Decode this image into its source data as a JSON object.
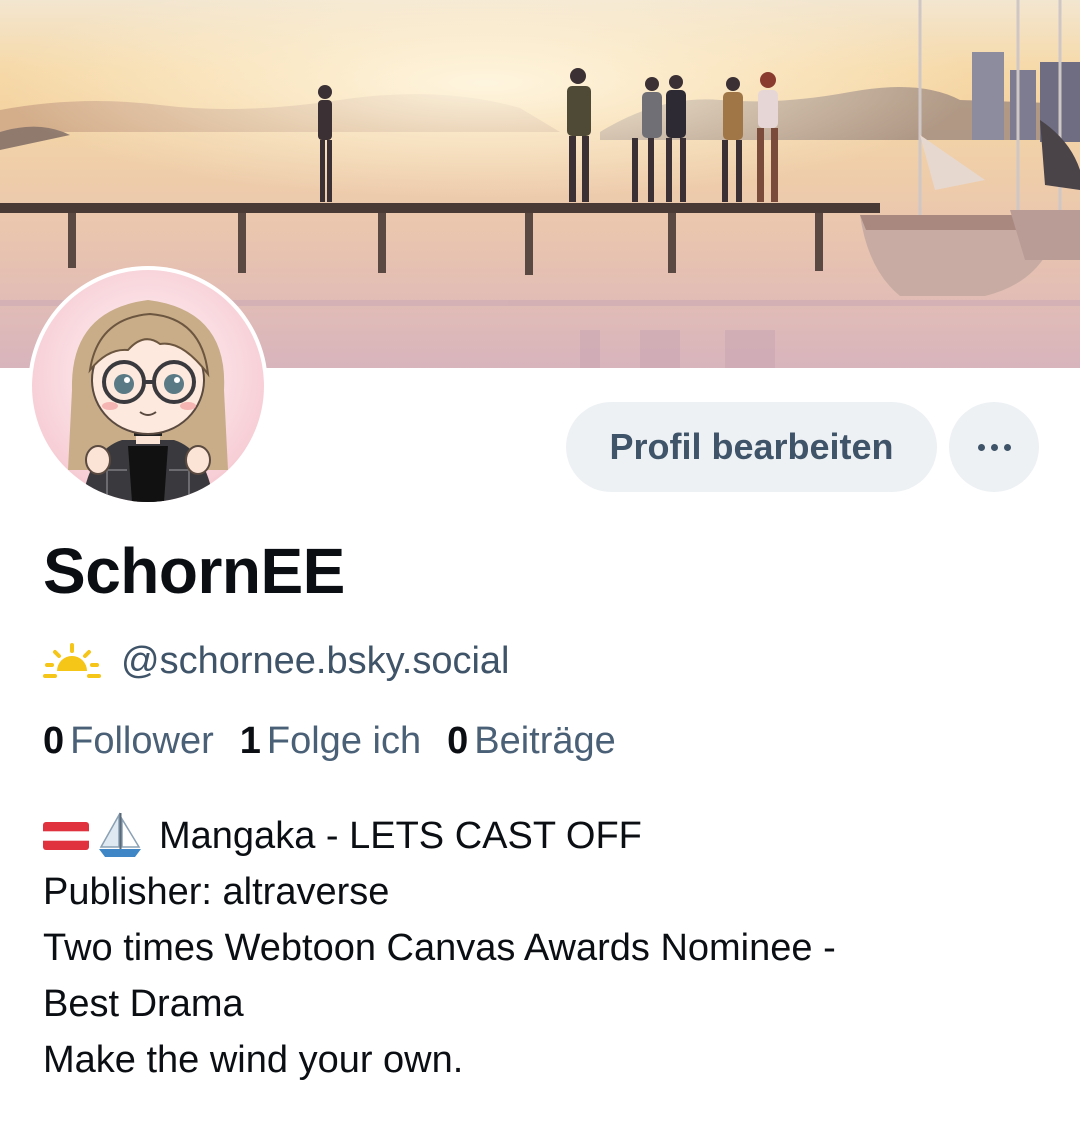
{
  "profile": {
    "display_name": "SchornEE",
    "handle": "@schornee.bsky.social",
    "handle_icon": "sunrise-emoji",
    "edit_label": "Profil bearbeiten",
    "more_icon": "ellipsis-icon"
  },
  "stats": [
    {
      "count": "0",
      "label": "Follower"
    },
    {
      "count": "1",
      "label": "Folge ich"
    },
    {
      "count": "0",
      "label": "Beiträge"
    }
  ],
  "bio": {
    "line1_emoji": [
      "austria-flag-emoji",
      "sailboat-emoji"
    ],
    "line1": "Mangaka - LETS CAST OFF",
    "line2": "Publisher: altraverse",
    "line3": "Two times Webtoon Canvas Awards Nominee -",
    "line4": "Best Drama",
    "line5": "Make the wind your own."
  },
  "colors": {
    "button_bg": "#eef1f4",
    "button_text": "#3f5468",
    "text_primary": "#0b0f14",
    "text_secondary": "#4a6076",
    "sun_yellow": "#f5c518"
  }
}
